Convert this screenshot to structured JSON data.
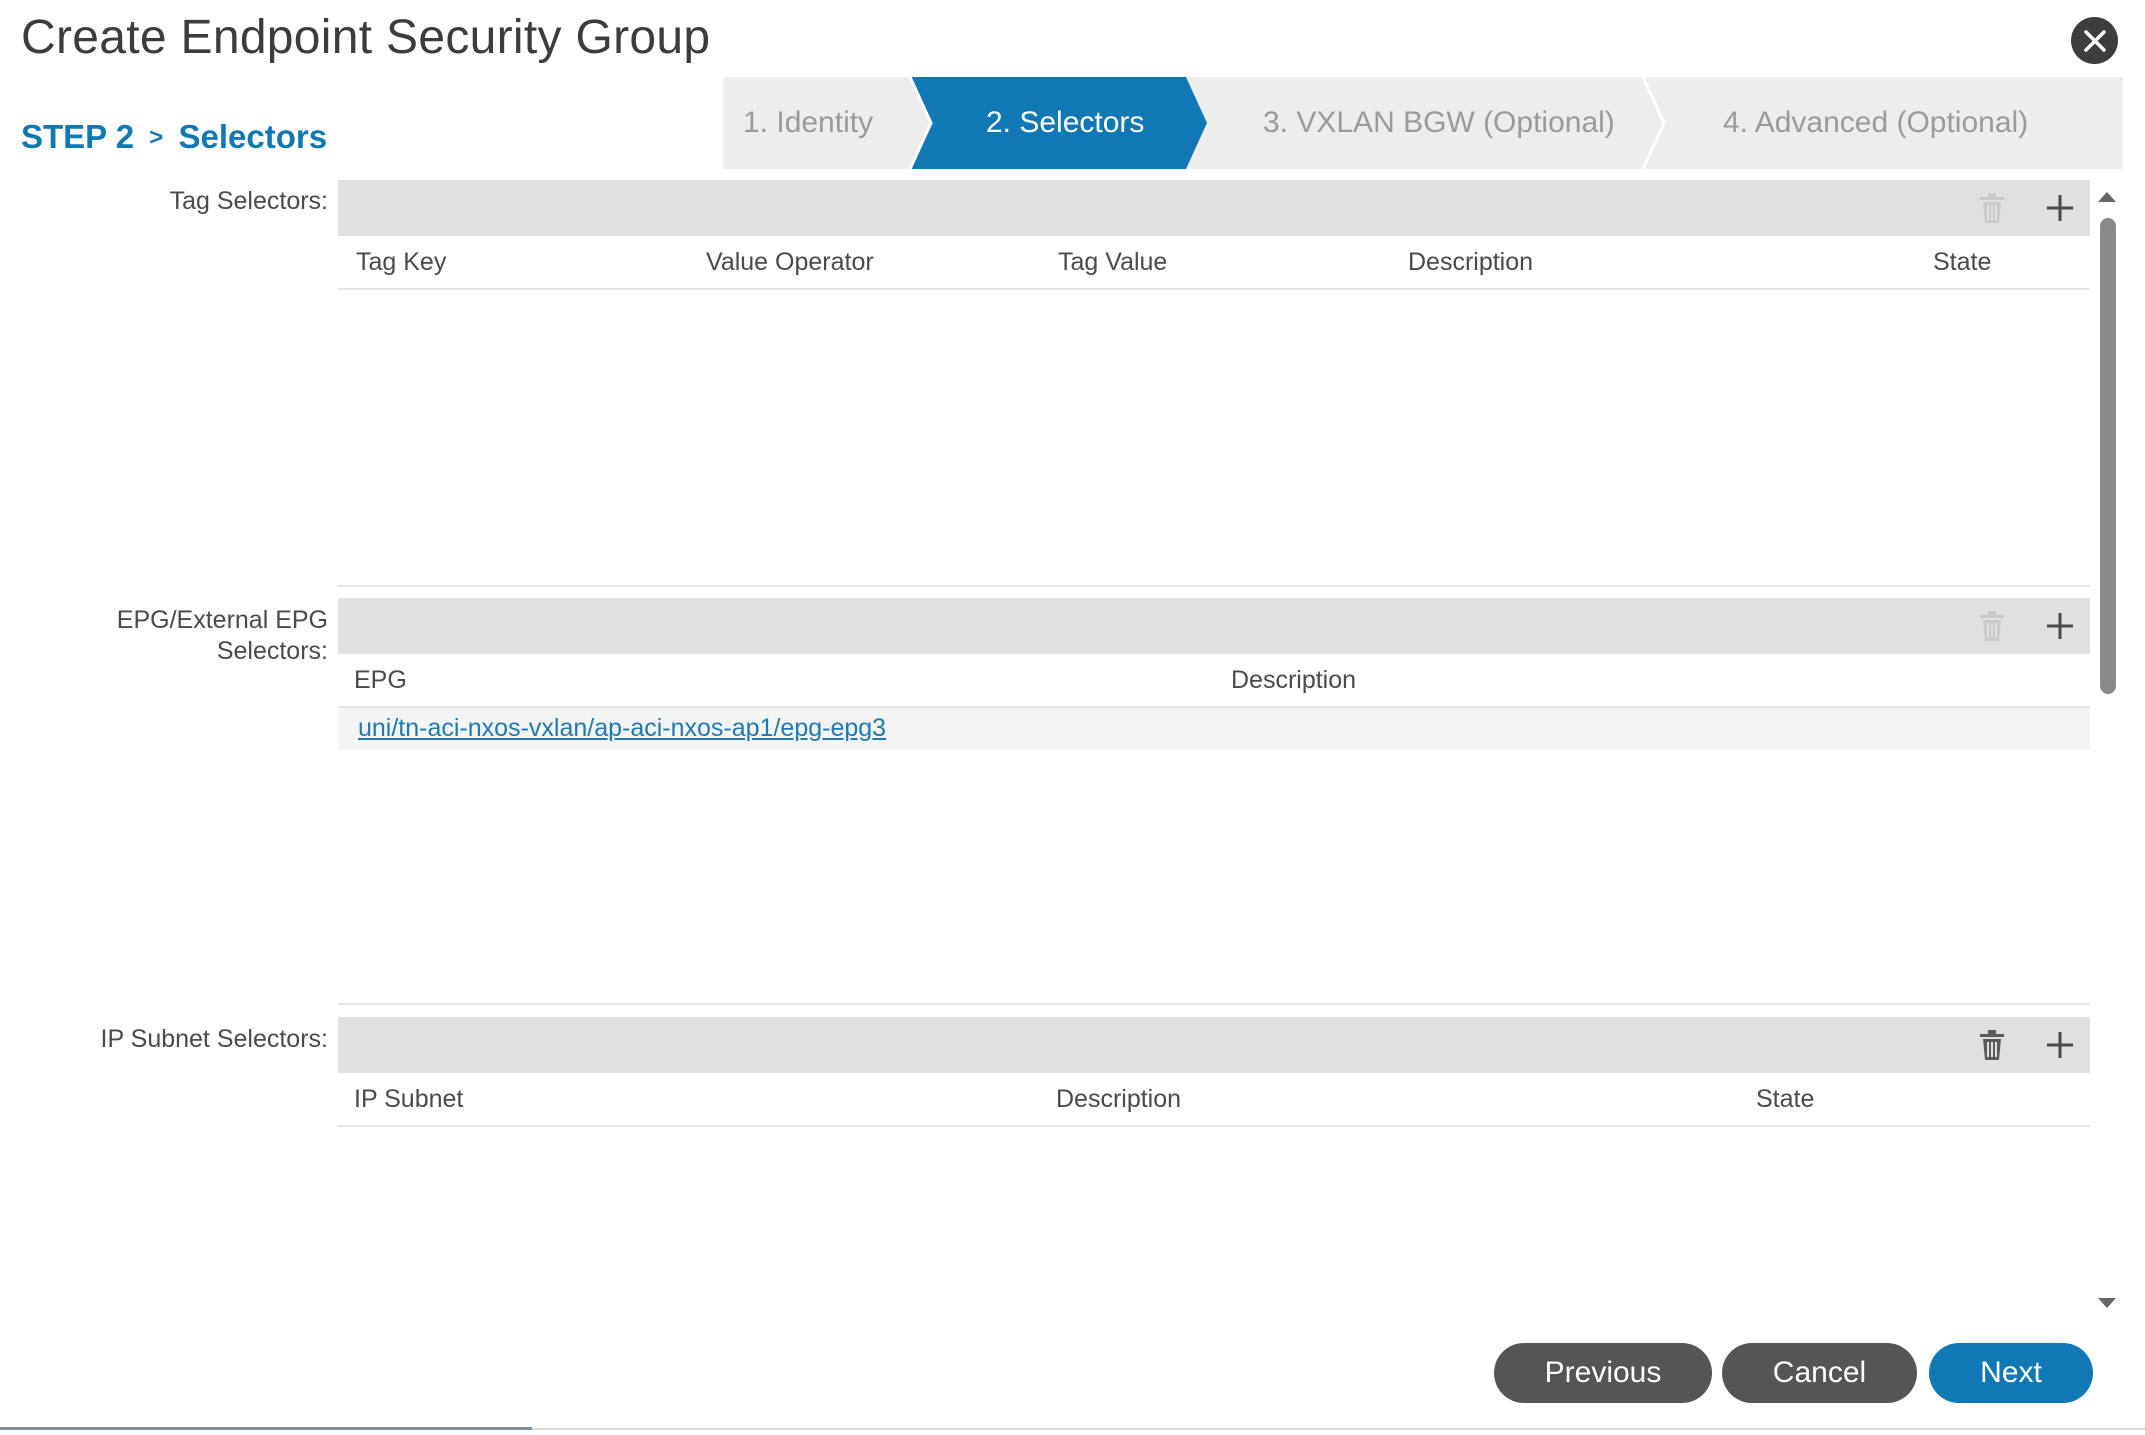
{
  "dialog": {
    "title": "Create Endpoint Security Group"
  },
  "step": {
    "prefix": "STEP 2",
    "separator": ">",
    "name": "Selectors"
  },
  "wizard": {
    "steps": [
      {
        "label": "1. Identity",
        "active": false
      },
      {
        "label": "2. Selectors",
        "active": true
      },
      {
        "label": "3. VXLAN BGW (Optional)",
        "active": false
      },
      {
        "label": "4. Advanced (Optional)",
        "active": false
      }
    ],
    "active_color": "#1079b5"
  },
  "tag_selectors": {
    "label": "Tag Selectors:",
    "columns": [
      "Tag Key",
      "Value Operator",
      "Tag Value",
      "Description",
      "State"
    ]
  },
  "epg_selectors": {
    "label_line1": "EPG/External EPG",
    "label_line2": "Selectors:",
    "columns": [
      "EPG",
      "Description"
    ],
    "rows": [
      {
        "epg": "uni/tn-aci-nxos-vxlan/ap-aci-nxos-ap1/epg-epg3",
        "description": ""
      }
    ]
  },
  "ip_subnet_selectors": {
    "label": "IP Subnet Selectors:",
    "columns": [
      "IP Subnet",
      "Description",
      "State"
    ]
  },
  "icons": {
    "close": "close-icon",
    "delete": "trash-icon",
    "add": "plus-icon"
  },
  "footer": {
    "previous_label": "Previous",
    "cancel_label": "Cancel",
    "next_label": "Next"
  }
}
